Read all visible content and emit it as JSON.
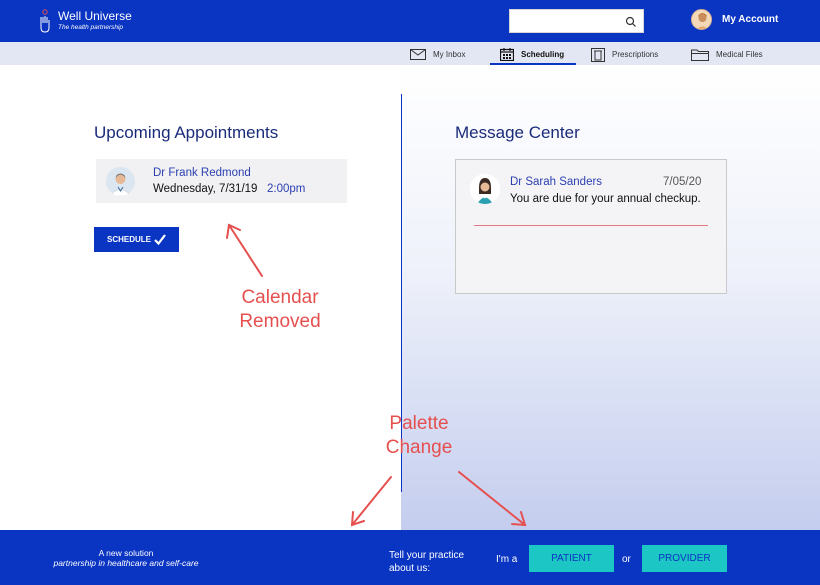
{
  "header": {
    "brand_name": "Well Universe",
    "brand_tagline": "The health partnership",
    "search_placeholder": "",
    "account_label": "My Account"
  },
  "nav": {
    "items": [
      {
        "label": "My Inbox",
        "icon": "envelope-icon"
      },
      {
        "label": "Scheduling",
        "icon": "calendar-icon",
        "active": true
      },
      {
        "label": "Prescriptions",
        "icon": "prescription-icon"
      },
      {
        "label": "Medical Files",
        "icon": "folder-icon"
      }
    ]
  },
  "appointments": {
    "title": "Upcoming Appointments",
    "items": [
      {
        "doctor": "Dr Frank Redmond",
        "date": "Wednesday, 7/31/19",
        "time": "2:00pm"
      }
    ],
    "schedule_label": "SCHEDULE"
  },
  "messages": {
    "title": "Message Center",
    "items": [
      {
        "sender": "Dr Sarah Sanders",
        "date": "7/05/20",
        "text": "You are due for your annual checkup."
      }
    ]
  },
  "annotations": {
    "calendar_line1": "Calendar",
    "calendar_line2": "Removed",
    "palette_line1": "Palette",
    "palette_line2": "Change"
  },
  "footer": {
    "tagline_1": "A new solution",
    "tagline_2": "partnership in healthcare and self-care",
    "prompt_line1": "Tell your practice",
    "prompt_line2": "about us:",
    "im_a": "I'm a",
    "patient_label": "PATIENT",
    "or_label": "or",
    "provider_label": "PROVIDER"
  },
  "colors": {
    "primary": "#0a34c2",
    "accent": "#1bc6c4",
    "annotation": "#e5504f"
  }
}
